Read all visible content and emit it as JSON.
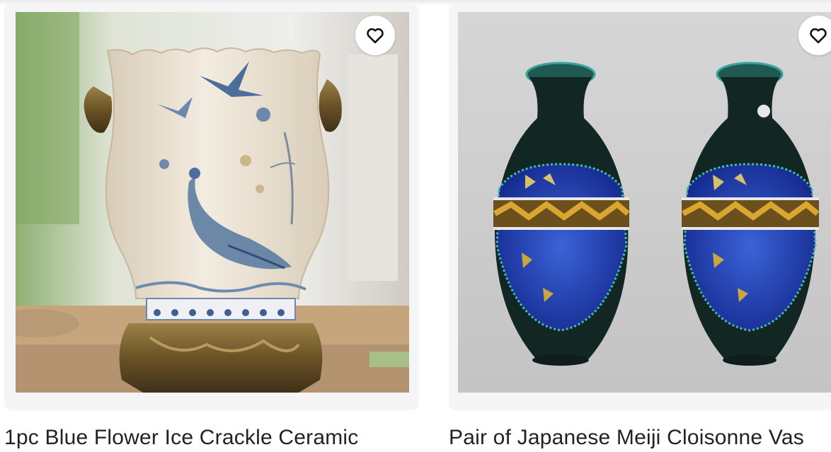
{
  "products": [
    {
      "title": "1pc Blue Flower Ice Crackle Ceramic",
      "image_alt": "Cream crackle ceramic vase with peacock and birds, brass handles and ornate base",
      "favorite_icon": "heart-outline-icon"
    },
    {
      "title": "Pair of Japanese Meiji Cloisonne Vas",
      "image_alt": "Pair of dark green and blue cloisonne vases with butterfly panels",
      "favorite_icon": "heart-outline-icon"
    }
  ]
}
